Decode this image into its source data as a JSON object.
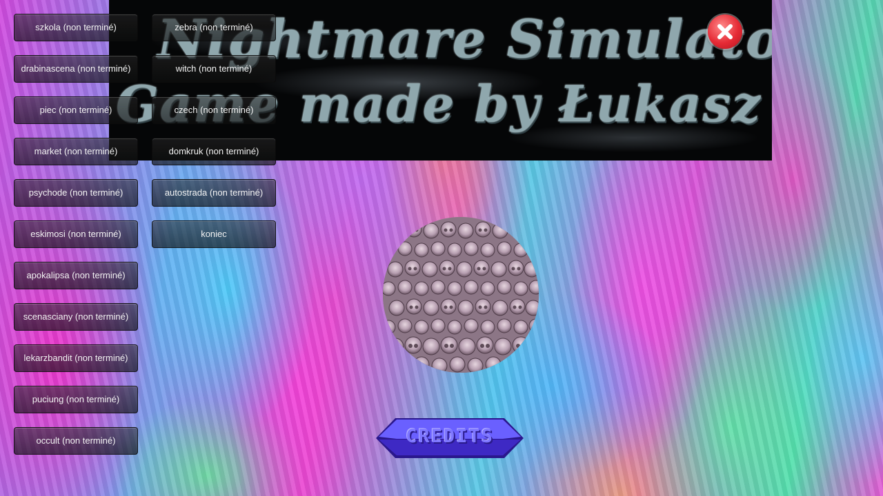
{
  "banner": {
    "line1": "Nightmare Simulator",
    "line2": "Game made by Łukasz Olszewski"
  },
  "levels_left": [
    "szkola (non terminé)",
    "drabinascena (non terminé)",
    "piec (non terminé)",
    "market (non terminé)",
    "psychode (non terminé)",
    "eskimosi (non terminé)",
    "apokalipsa (non terminé)",
    "scenasciany (non terminé)",
    "lekarzbandit (non terminé)",
    "puciung (non terminé)",
    "occult (non terminé)"
  ],
  "levels_right": [
    "zebra (non terminé)",
    "witch (non terminé)",
    "czech (non terminé)",
    "domkruk (non terminé)",
    "autostrada (non terminé)",
    "koniec"
  ],
  "credits": {
    "label": "CREDITS"
  },
  "icons": {
    "close": "close-x-icon"
  },
  "colors": {
    "close_red": "#e52a35",
    "credits_blue": "#5b4cff",
    "banner_text": "#8fa7ad"
  }
}
